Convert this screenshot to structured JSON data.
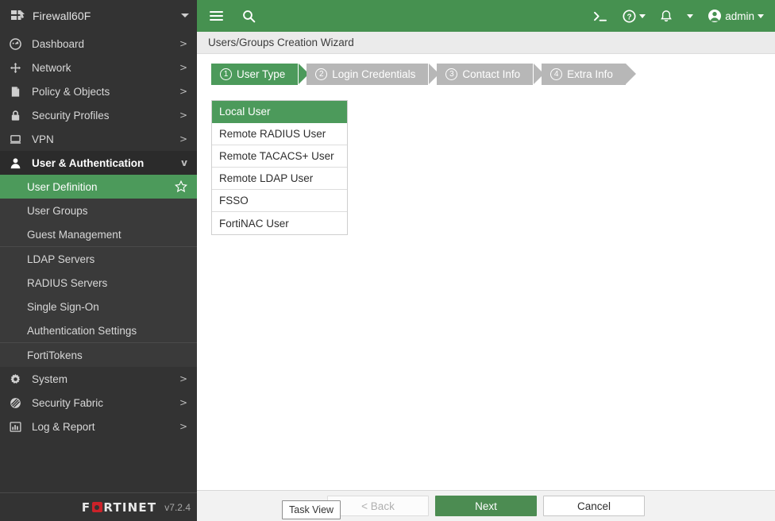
{
  "sidebar": {
    "device": {
      "name": "Firewall60F",
      "icon": "device-icon",
      "caret": "chevron-down-icon"
    },
    "items": [
      {
        "label": "Dashboard",
        "icon": "dashboard-icon",
        "chevron": ">"
      },
      {
        "label": "Network",
        "icon": "network-icon",
        "chevron": ">"
      },
      {
        "label": "Policy & Objects",
        "icon": "policy-icon",
        "chevron": ">"
      },
      {
        "label": "Security Profiles",
        "icon": "lock-icon",
        "chevron": ">"
      },
      {
        "label": "VPN",
        "icon": "monitor-icon",
        "chevron": ">"
      },
      {
        "label": "User & Authentication",
        "icon": "user-icon",
        "chevron": "v",
        "expanded": true
      }
    ],
    "sub_items": [
      {
        "label": "User Definition",
        "active": true,
        "star": "star-icon"
      },
      {
        "label": "User Groups",
        "active": false
      },
      {
        "label": "Guest Management",
        "active": false
      },
      {
        "label": "LDAP Servers",
        "active": false
      },
      {
        "label": "RADIUS Servers",
        "active": false
      },
      {
        "label": "Single Sign-On",
        "active": false
      },
      {
        "label": "Authentication Settings",
        "active": false
      },
      {
        "label": "FortiTokens",
        "active": false
      }
    ],
    "items_after": [
      {
        "label": "System",
        "icon": "gear-icon",
        "chevron": ">"
      },
      {
        "label": "Security Fabric",
        "icon": "security-fabric-icon",
        "chevron": ">"
      },
      {
        "label": "Log & Report",
        "icon": "chart-bar-icon",
        "chevron": ">"
      }
    ],
    "brand": {
      "name_part1": "F",
      "name_part2": "RTINET",
      "version": "v7.2.4"
    }
  },
  "topbar": {
    "menu_icon": "hamburger-icon",
    "search_icon": "search-icon",
    "cli_icon": "cli-console-icon",
    "help_icon": "help-icon",
    "notification_icon": "bell-icon",
    "admin_icon": "user-avatar-icon",
    "admin_label": "admin"
  },
  "breadcrumb": {
    "title": "Users/Groups Creation Wizard"
  },
  "wizard": {
    "steps": [
      {
        "num": "1",
        "label": "User Type",
        "active": true
      },
      {
        "num": "2",
        "label": "Login Credentials",
        "active": false
      },
      {
        "num": "3",
        "label": "Contact Info",
        "active": false
      },
      {
        "num": "4",
        "label": "Extra Info",
        "active": false
      }
    ]
  },
  "user_types": [
    {
      "label": "Local User",
      "selected": true
    },
    {
      "label": "Remote RADIUS User",
      "selected": false
    },
    {
      "label": "Remote TACACS+ User",
      "selected": false
    },
    {
      "label": "Remote LDAP User",
      "selected": false
    },
    {
      "label": "FSSO",
      "selected": false
    },
    {
      "label": "FortiNAC User",
      "selected": false
    }
  ],
  "footer": {
    "task_view": "Task View",
    "back": "< Back",
    "next": "Next",
    "cancel": "Cancel"
  },
  "colors": {
    "brand_green": "#469150",
    "accent_green": "#4c9a5b",
    "primary_button": "#4c8c52",
    "sidebar_bg": "#333333",
    "subnav_bg": "#3a3a3a",
    "logo_red": "#cc2229",
    "step_inactive": "#b7b7b7"
  }
}
